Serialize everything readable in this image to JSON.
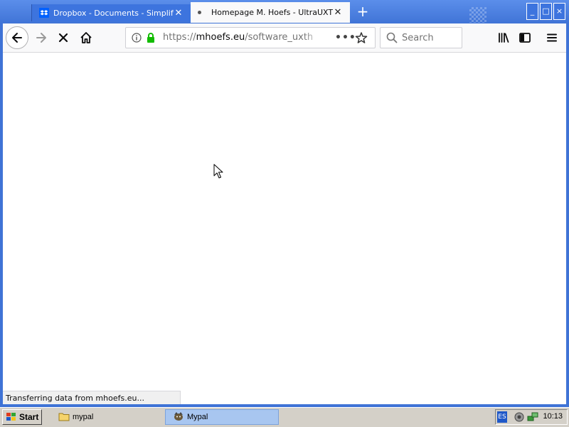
{
  "browser": {
    "tabs": [
      {
        "title": "Dropbox - Documents - Simplify your life",
        "active": false,
        "favicon": "dropbox-icon"
      },
      {
        "title": "Homepage M. Hoefs - UltraUXThemePatcher",
        "active": true,
        "favicon": "loading-dot"
      }
    ],
    "new_tab_symbol": "+",
    "window_controls": {
      "minimize": "_",
      "maximize": "□",
      "close": "×"
    },
    "url": {
      "scheme": "https://",
      "host": "mhoefs.eu",
      "path": "/software_uxtheme"
    },
    "search_placeholder": "Search",
    "status_text": "Transferring data from mhoefs.eu..."
  },
  "taskbar": {
    "start_label": "Start",
    "items": [
      {
        "label": "mypal",
        "icon": "folder-icon",
        "active": false
      },
      {
        "label": "Mypal",
        "icon": "mypal-icon",
        "active": true
      }
    ],
    "tray": {
      "language": "ES",
      "clock": "10:13"
    }
  },
  "colors": {
    "titlebar": "#3f73d6",
    "active_tab": "#f9f9fa",
    "taskbar": "#d4d0c8",
    "active_task": "#a8c6f0",
    "lock_green": "#12bc00"
  }
}
